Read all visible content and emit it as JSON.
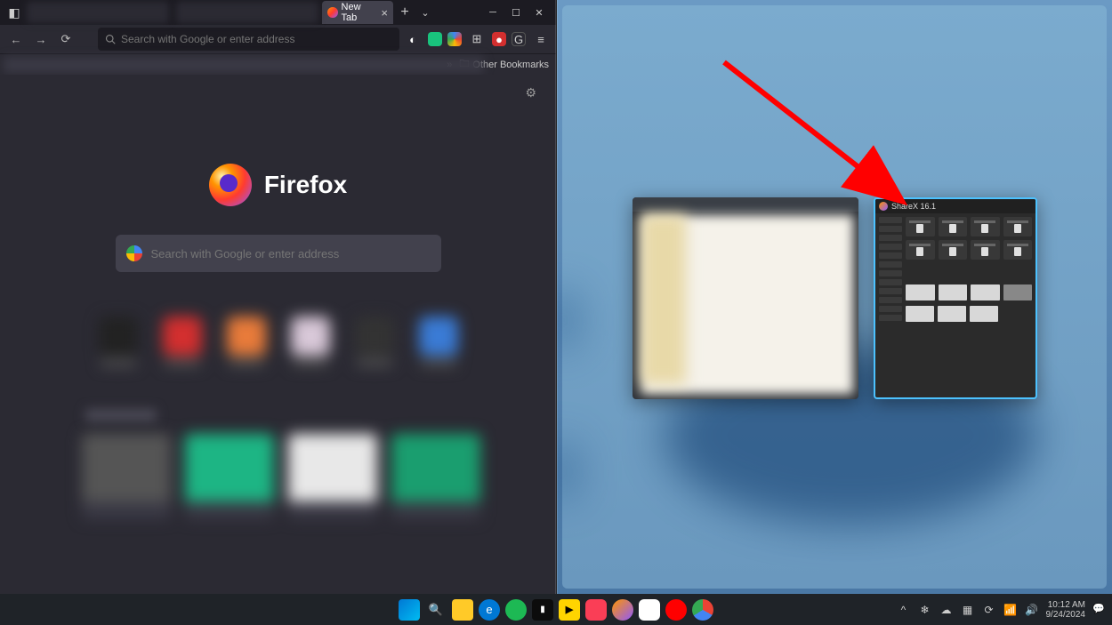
{
  "firefox": {
    "tab_label": "New Tab",
    "url_placeholder": "Search with Google or enter address",
    "bookmarks_overflow": "Other Bookmarks",
    "logo_text": "Firefox",
    "search_placeholder": "Search with Google or enter address"
  },
  "snap": {
    "sharex_title": "ShareX 16.1"
  },
  "taskbar": {
    "time": "10:12 AM",
    "date": "9/24/2024"
  }
}
